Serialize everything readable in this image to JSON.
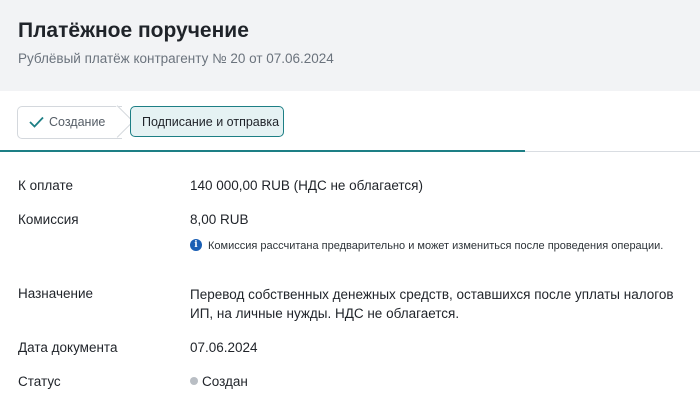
{
  "header": {
    "title": "Платёжное поручение",
    "subtitle": "Рублёвый платёж контрагенту № 20 от 07.06.2024"
  },
  "steps": [
    {
      "label": "Создание",
      "state": "done"
    },
    {
      "label": "Подписание и отправка",
      "state": "active"
    }
  ],
  "progress_percent": 75,
  "details": {
    "amount_label": "К оплате",
    "amount_value": "140 000,00 RUB (НДС не облагается)",
    "fee_label": "Комиссия",
    "fee_value": "8,00 RUB",
    "fee_note": "Комиссия рассчитана предварительно и может измениться после проведения операции.",
    "purpose_label": "Назначение",
    "purpose_value": "Перевод собственных денежных средств, оставшихся после уплаты налогов ИП, на личные нужды. НДС не облагается.",
    "date_label": "Дата документа",
    "date_value": "07.06.2024",
    "status_label": "Статус",
    "status_value": "Создан"
  },
  "colors": {
    "accent": "#1d7f85",
    "info": "#1a5fb4",
    "status_dot": "#b9bec4",
    "header_bg": "#f2f3f5"
  }
}
